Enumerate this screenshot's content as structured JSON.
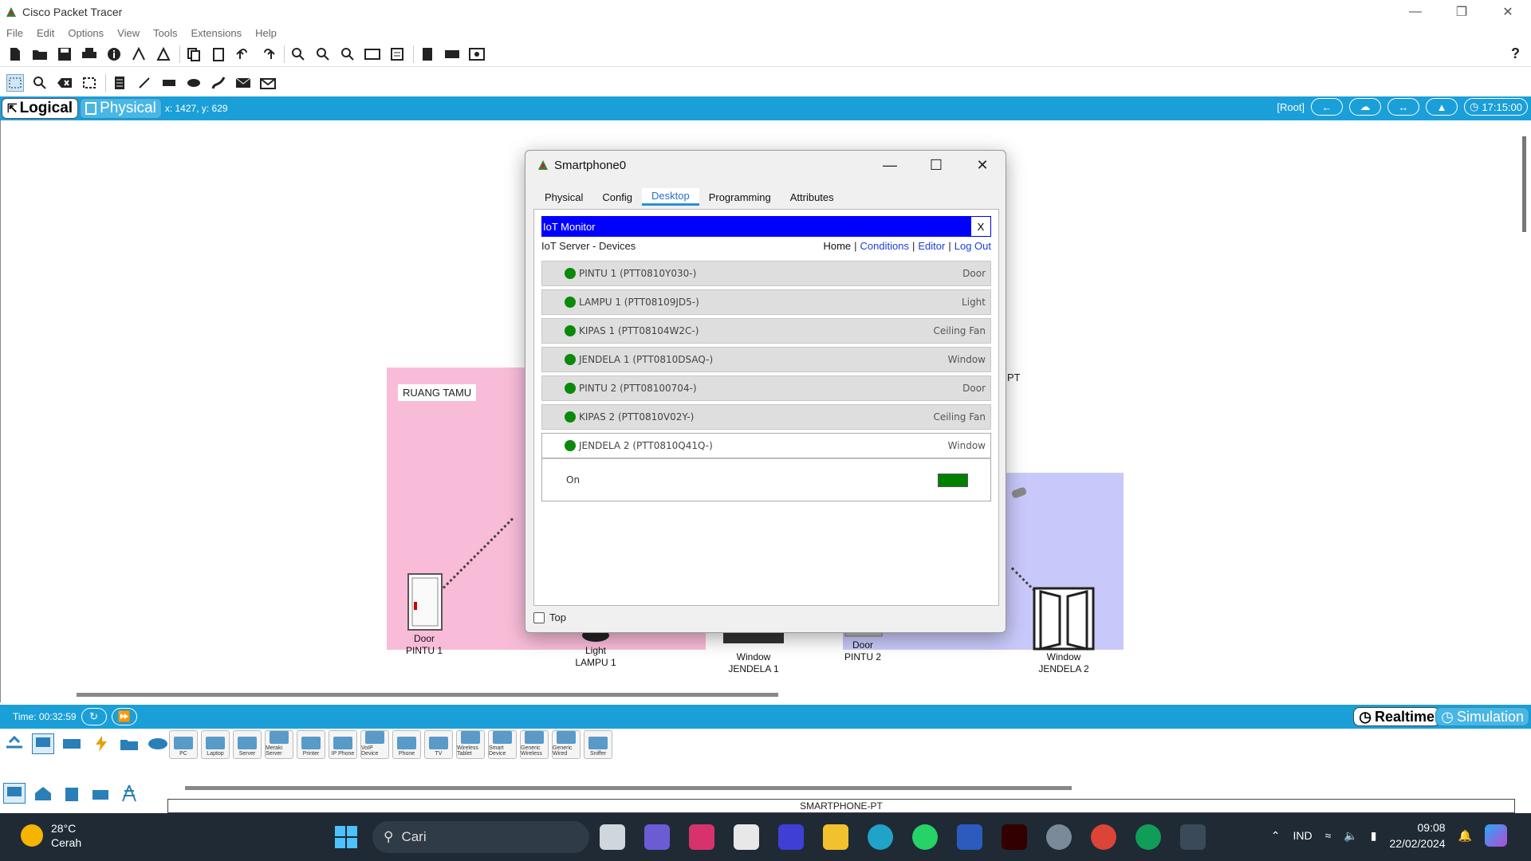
{
  "app": {
    "title": "Cisco Packet Tracer",
    "window_controls": [
      "minimize",
      "restore",
      "close"
    ]
  },
  "menu": [
    "File",
    "Edit",
    "Options",
    "View",
    "Tools",
    "Extensions",
    "Help"
  ],
  "toolbar1_icons": [
    "new-icon",
    "open-icon",
    "save-icon",
    "print-icon",
    "info-icon",
    "network-wizard-icon",
    "activity-wizard-icon",
    "copy-icon",
    "paste-icon",
    "undo-icon",
    "redo-icon",
    "zoom-in-icon",
    "zoom-reset-icon",
    "zoom-out-icon",
    "drawing-palette-icon",
    "custom-device-icon",
    "cluster-icon",
    "view-icon",
    "screenshot-icon"
  ],
  "toolbar1_help": "?",
  "toolbar2_icons": [
    "select-icon",
    "inspect-icon",
    "delete-icon",
    "resize-icon",
    "note-icon",
    "line-icon",
    "rectangle-icon",
    "ellipse-icon",
    "freeform-icon",
    "add-simple-pdu-icon",
    "add-complex-pdu-icon"
  ],
  "workspace": {
    "logical_label": "Logical",
    "physical_label": "Physical",
    "coords": "x: 1427, y: 629",
    "root_label": "[Root]",
    "clock": "17:15:00"
  },
  "canvas": {
    "room_label": "RUANG TAMU",
    "pt_label": "PT",
    "devices": [
      {
        "type": "Door",
        "name": "PINTU 1"
      },
      {
        "type": "Light",
        "name": "LAMPU 1"
      },
      {
        "type": "Window",
        "name": "JENDELA 1"
      },
      {
        "type": "Door",
        "name": "PINTU 2"
      },
      {
        "type": "Window",
        "name": "JENDELA 2"
      }
    ]
  },
  "bottom_bar": {
    "time": "Time: 00:32:59",
    "realtime_label": "Realtime",
    "simulation_label": "Simulation"
  },
  "device_panel": {
    "devices": [
      "PC",
      "Laptop",
      "Server",
      "Meraki Server",
      "Printer",
      "IP Phone",
      "VoIP Device",
      "Phone",
      "TV",
      "Wireless Tablet",
      "Smart Device",
      "Generic Wireless",
      "Generic Wired",
      "Sniffer"
    ],
    "selected_name": "SMARTPHONE-PT"
  },
  "dialog": {
    "title": "Smartphone0",
    "tabs": [
      "Physical",
      "Config",
      "Desktop",
      "Programming",
      "Attributes"
    ],
    "active_tab": "Desktop",
    "iot": {
      "header": "IoT Monitor",
      "close_label": "X",
      "subtitle": "IoT Server - Devices",
      "links": {
        "home": "Home",
        "sep": "|",
        "conditions": "Conditions",
        "editor": "Editor",
        "logout": "Log Out"
      },
      "devices": [
        {
          "name": "PINTU 1 (PTT0810Y030-)",
          "type": "Door"
        },
        {
          "name": "LAMPU 1 (PTT08109JD5-)",
          "type": "Light"
        },
        {
          "name": "KIPAS 1 (PTT08104W2C-)",
          "type": "Ceiling Fan"
        },
        {
          "name": "JENDELA 1 (PTT0810DSAQ-)",
          "type": "Window"
        },
        {
          "name": "PINTU 2 (PTT08100704-)",
          "type": "Door"
        },
        {
          "name": "KIPAS 2 (PTT0810V02Y-)",
          "type": "Ceiling Fan"
        },
        {
          "name": "JENDELA 2 (PTT0810Q41Q-)",
          "type": "Window"
        }
      ],
      "expanded_detail": {
        "label": "On",
        "state_color": "#008000"
      }
    },
    "top_checkbox_label": "Top"
  },
  "taskbar": {
    "weather_temp": "28°C",
    "weather_desc": "Cerah",
    "search_placeholder": "Cari",
    "lang": "IND",
    "time": "09:08",
    "date": "22/02/2024"
  }
}
